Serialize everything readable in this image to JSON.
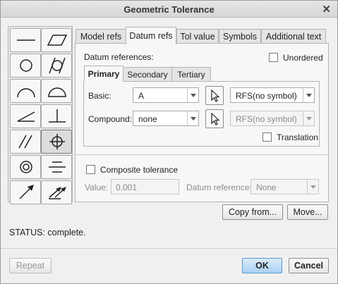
{
  "window": {
    "title": "Geometric Tolerance"
  },
  "palette": {
    "symbols": [
      "straightness-icon",
      "flatness-icon",
      "circularity-icon",
      "cylindricity-icon",
      "profile-of-line-icon",
      "profile-of-surface-icon",
      "angularity-icon",
      "perpendicularity-icon",
      "parallelism-icon",
      "position-icon",
      "concentricity-icon",
      "symmetry-icon",
      "circular-runout-icon",
      "total-runout-icon"
    ],
    "selected": "position-icon"
  },
  "tabs": [
    "Model refs",
    "Datum refs",
    "Tol value",
    "Symbols",
    "Additional text"
  ],
  "active_tab": "Datum refs",
  "datum": {
    "section_label": "Datum references:",
    "unordered_label": "Unordered",
    "subtabs": [
      "Primary",
      "Secondary",
      "Tertiary"
    ],
    "basic_label": "Basic:",
    "basic_value": "A",
    "basic_modifier": "RFS(no symbol)",
    "compound_label": "Compound:",
    "compound_value": "none",
    "compound_modifier": "RFS(no symbol)",
    "translation_label": "Translation"
  },
  "composite": {
    "label": "Composite tolerance",
    "value_label": "Value:",
    "value": "0.001",
    "datum_ref_label": "Datum reference:",
    "datum_ref_value": "None"
  },
  "buttons": {
    "copy_from": "Copy from...",
    "move": "Move...",
    "repeat": "Repeat",
    "ok": "OK",
    "cancel": "Cancel"
  },
  "status": "STATUS: complete."
}
